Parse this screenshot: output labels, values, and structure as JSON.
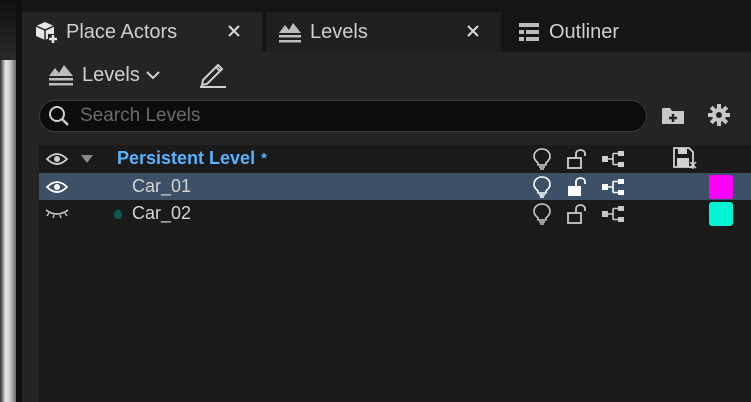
{
  "tabs": [
    {
      "label": "Place Actors",
      "icon": "place-actors-icon",
      "active": true,
      "closable": true
    },
    {
      "label": "Levels",
      "icon": "levels-icon",
      "active": false,
      "closable": true
    },
    {
      "label": "Outliner",
      "icon": "outliner-icon",
      "active": false,
      "closable": false
    }
  ],
  "toolbar": {
    "levels_label": "Levels",
    "levels_icon": "levels-icon",
    "pencil_icon": "pencil-icon"
  },
  "search": {
    "placeholder": "Search Levels",
    "value": ""
  },
  "list": {
    "header": {
      "label": "Persistent Level",
      "modified_marker": "*"
    },
    "rows": [
      {
        "label": "Car_01",
        "visible": true,
        "selected": true,
        "color": "#ff00ff"
      },
      {
        "label": "Car_02",
        "visible": false,
        "selected": false,
        "color": "#00f5d4"
      }
    ]
  },
  "colors": {
    "accent_blue": "#5ab2ff",
    "selected_row": "#3c5068",
    "panel_bg": "#242424",
    "list_bg": "#1a1a1a"
  }
}
